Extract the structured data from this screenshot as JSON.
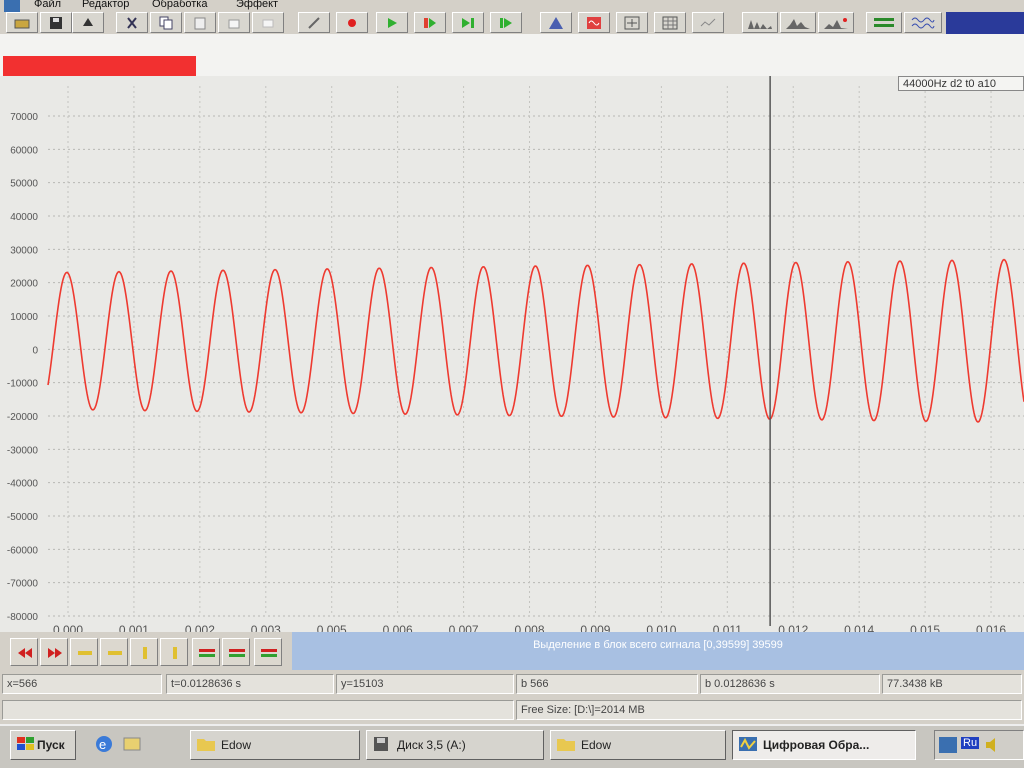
{
  "menu": {
    "items": [
      "Файл",
      "Редактор",
      "Обработка",
      "Эффект"
    ]
  },
  "toolbar": {
    "buttons": [
      "open-icon",
      "save-icon",
      "reload-icon",
      "cut-icon",
      "copy-icon",
      "paste-icon",
      "select-all-icon",
      "clear-icon",
      "wand-icon",
      "record-icon",
      "play-icon",
      "play-selection-icon",
      "play-to-end-icon",
      "loop-icon",
      "mountain-icon",
      "wave-icon",
      "spectrum-icon",
      "grid-icon",
      "envelope-icon",
      "histogram-icon",
      "spectrum-icon",
      "peak-icon",
      "channels-icon",
      "waveform-icon"
    ]
  },
  "plot": {
    "rate_info": "44000Hz d2 t0 a10",
    "y_ticks": [
      "70000",
      "60000",
      "50000",
      "40000",
      "30000",
      "20000",
      "10000",
      "0",
      "-10000",
      "-20000",
      "-30000",
      "-40000",
      "-50000",
      "-60000",
      "-70000",
      "-80000"
    ],
    "x_ticks": [
      "0.000",
      "0.001",
      "0.002",
      "0.003",
      "0.005",
      "0.006",
      "0.007",
      "0.008",
      "0.009",
      "0.010",
      "0.011",
      "0.012",
      "0.014",
      "0.015",
      "0.016"
    ],
    "cursor_time": "0.012",
    "wave_color": "#ee3a30"
  },
  "chart_data": {
    "type": "line",
    "title": "",
    "xlabel": "",
    "ylabel": "",
    "xlim": [
      0.0,
      0.0163
    ],
    "ylim": [
      -80000,
      75000
    ],
    "series": [
      {
        "frequency_hz": 1150,
        "amplitude_start": 20500,
        "amplitude_end": 24500,
        "offset": 2500,
        "start_phase": -0.7
      }
    ],
    "cursor_x": 0.01206
  },
  "transport": {
    "buttons": [
      "rewind-start-icon",
      "rewind-icon",
      "step-back-icon",
      "step-forward-icon",
      "marker-left-icon",
      "marker-right-icon",
      "zoom-in-icon",
      "zoom-out-icon",
      "fit-icon"
    ],
    "selection_text": "Выделение в блок всего сигнала [0,39599] 39599"
  },
  "status": {
    "x": "x=566",
    "t": "t=0.0128636 s",
    "y": "y=15103",
    "b": "b 566",
    "bt": "b 0.0128636 s",
    "size": "77.3438 kB",
    "free": "Free Size: [D:\\]=2014 MB"
  },
  "taskbar": {
    "start_label": "Пуск",
    "tasks": [
      "Edow",
      "Диск 3,5 (A:)",
      "Edow",
      "Цифровая Обра..."
    ],
    "tray_lang": "Ru"
  }
}
